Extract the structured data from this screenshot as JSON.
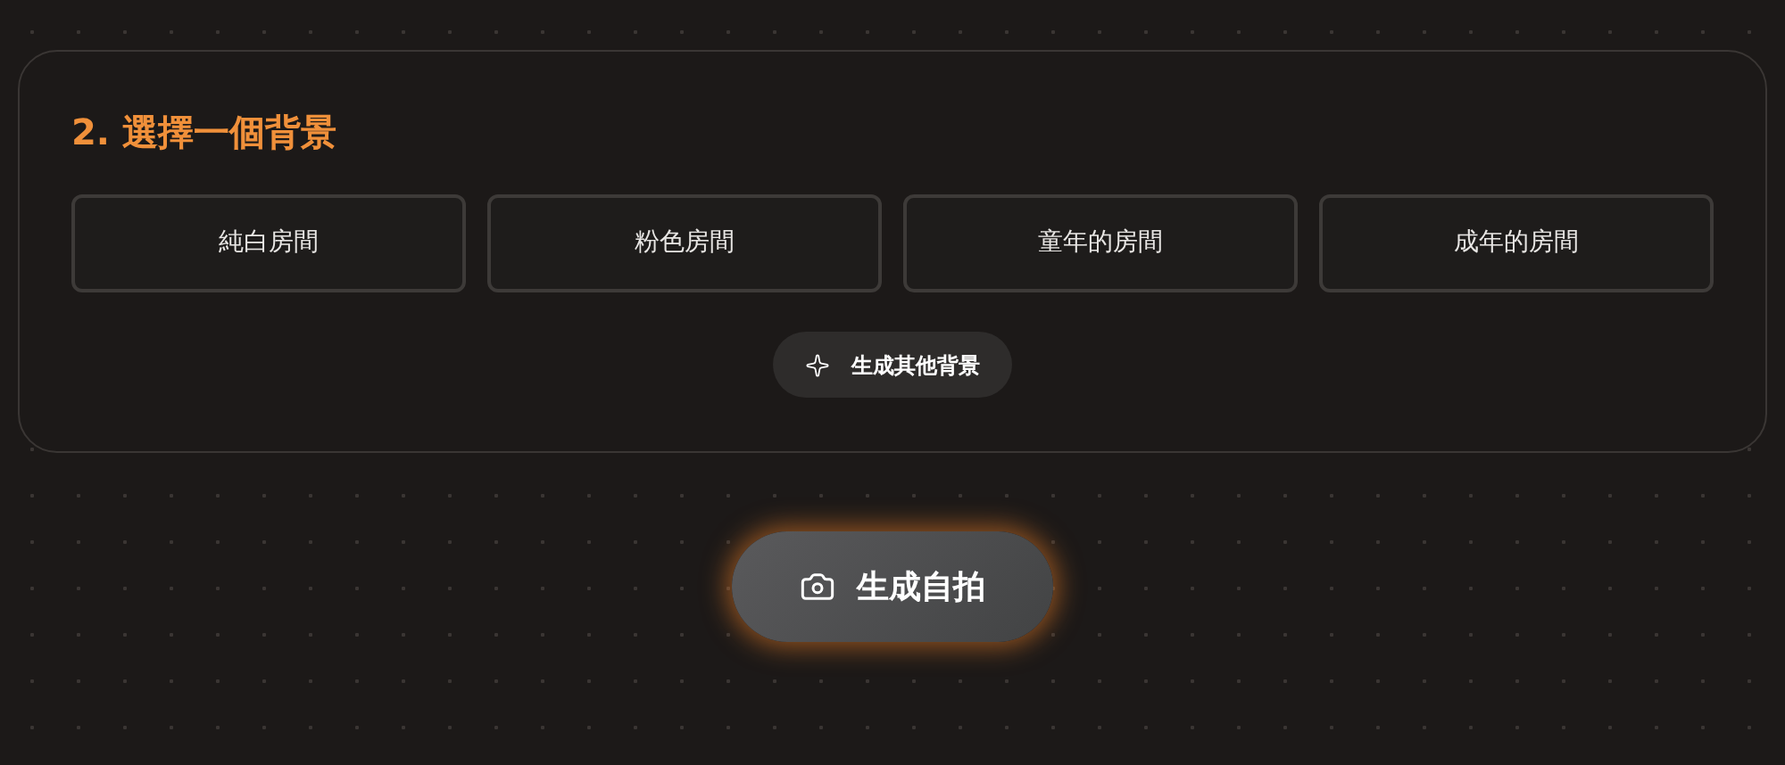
{
  "section": {
    "title": "2. 選擇一個背景",
    "options": [
      {
        "label": "純白房間"
      },
      {
        "label": "粉色房間"
      },
      {
        "label": "童年的房間"
      },
      {
        "label": "成年的房間"
      }
    ],
    "more_button": {
      "label": "生成其他背景"
    }
  },
  "primary_button": {
    "label": "生成自拍"
  }
}
